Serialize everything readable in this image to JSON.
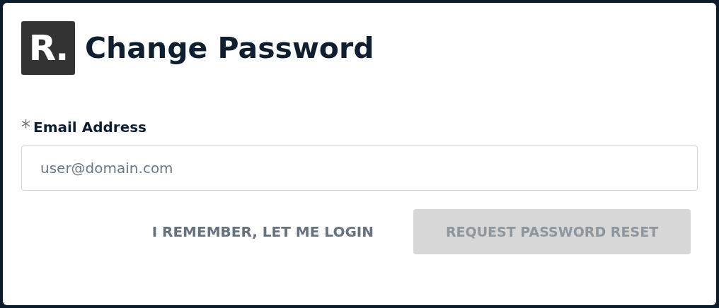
{
  "logo": {
    "text": "R."
  },
  "title": "Change Password",
  "email_field": {
    "required_mark": "*",
    "label": "Email Address",
    "placeholder": "user@domain.com",
    "required": true
  },
  "buttons": [
    {
      "kind": "link",
      "label": "I REMEMBER, LET ME LOGIN",
      "disabled": false
    },
    {
      "kind": "primary",
      "label": "REQUEST PASSWORD RESET",
      "disabled": true
    }
  ]
}
